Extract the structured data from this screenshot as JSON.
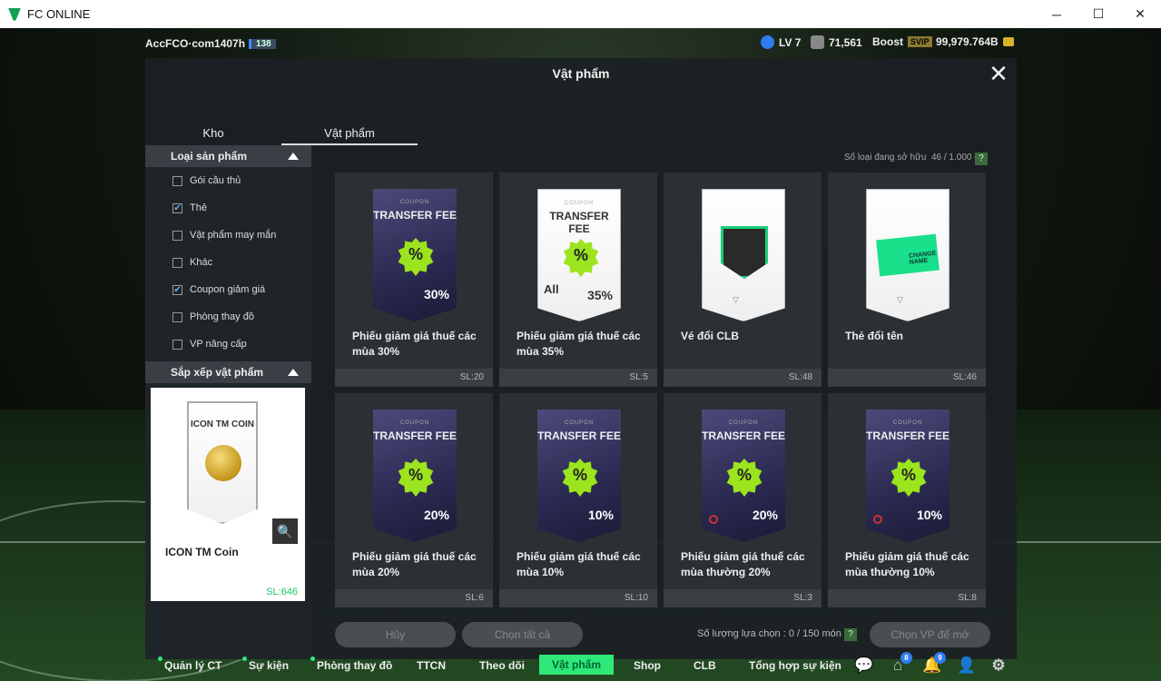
{
  "window": {
    "title": "FC ONLINE",
    "minimize": "─",
    "maximize": "☐",
    "close": "✕"
  },
  "header": {
    "account": "AccFCO·com1407h",
    "account_level": "138",
    "level": "LV 7",
    "fc_points": "71,561",
    "boost": "Boost",
    "svip": "SVIP",
    "coins": "99,979.764B"
  },
  "panel": {
    "title": "Vật phẩm",
    "close": "✕",
    "tabs": [
      {
        "label": "Kho"
      },
      {
        "label": "Vật phẩm"
      }
    ]
  },
  "filters": {
    "product_type_title": "Loại sản phẩm",
    "items": [
      {
        "label": "Gói cầu thủ",
        "checked": false
      },
      {
        "label": "Thẻ",
        "checked": true
      },
      {
        "label": "Vật phẩm may mắn",
        "checked": false
      },
      {
        "label": "Khác",
        "checked": false
      },
      {
        "label": "Coupon giảm giá",
        "checked": true
      },
      {
        "label": "Phòng thay đồ",
        "checked": false
      },
      {
        "label": "VP nâng cấp",
        "checked": false
      }
    ],
    "sort_title": "Sắp xếp vật phẩm"
  },
  "preview": {
    "card_title": "ICON TM COIN",
    "name": "ICON TM Coin",
    "qty": "SL:646"
  },
  "inventory": {
    "label": "Số loại đang sở hữu",
    "count": "46 / 1.000 cái",
    "help": "?"
  },
  "items": [
    {
      "name": "Phiếu giảm giá thuế các mùa 30%",
      "qty": "SL:20",
      "coupon": "COUPON",
      "header": "TRANSFER FEE",
      "pct": "30%",
      "style": "dark"
    },
    {
      "name": "Phiếu giảm giá thuế các mùa 35%",
      "qty": "SL:5",
      "coupon": "COUPON",
      "header": "TRANSFER FEE",
      "pct": "35%",
      "style": "light",
      "extra": "All"
    },
    {
      "name": "Vé đổi CLB",
      "qty": "SL:48",
      "style": "club"
    },
    {
      "name": "Thẻ đổi tên",
      "qty": "SL:46",
      "style": "rename",
      "ticket_text": "CHANGE NAME"
    },
    {
      "name": "Phiếu giảm giá thuế các mùa 20%",
      "qty": "SL:6",
      "coupon": "COUPON",
      "header": "TRANSFER FEE",
      "pct": "20%",
      "style": "dark"
    },
    {
      "name": "Phiếu giảm giá thuế các mùa 10%",
      "qty": "SL:10",
      "coupon": "COUPON",
      "header": "TRANSFER FEE",
      "pct": "10%",
      "style": "dark"
    },
    {
      "name": "Phiếu giảm giá thuế các mùa thường 20%",
      "qty": "SL:3",
      "coupon": "COUPON",
      "header": "TRANSFER FEE",
      "pct": "20%",
      "style": "dark-ban"
    },
    {
      "name": "Phiếu giảm giá thuế các mùa thường 10%",
      "qty": "SL:8",
      "coupon": "COUPON",
      "header": "TRANSFER FEE",
      "pct": "10%",
      "style": "dark-ban"
    }
  ],
  "actions": {
    "cancel": "Hủy",
    "select_all": "Chọn tất cả",
    "selection_label": "Số lượng lựa chọn : 0 / 150 món",
    "help": "?",
    "open": "Chọn VP để mở"
  },
  "nav": {
    "items": [
      {
        "label": "Quản lý CT",
        "dot": true
      },
      {
        "label": "Sự kiện",
        "dot": true
      },
      {
        "label": "Phòng thay đồ",
        "dot": true
      },
      {
        "label": "TTCN"
      },
      {
        "label": "Theo dõi"
      },
      {
        "label": "Vật phẩm",
        "active": true
      },
      {
        "label": "Shop"
      },
      {
        "label": "CLB"
      },
      {
        "label": "Tổng hợp sự kiện"
      }
    ],
    "home_count": "8",
    "bell_count": "9"
  }
}
